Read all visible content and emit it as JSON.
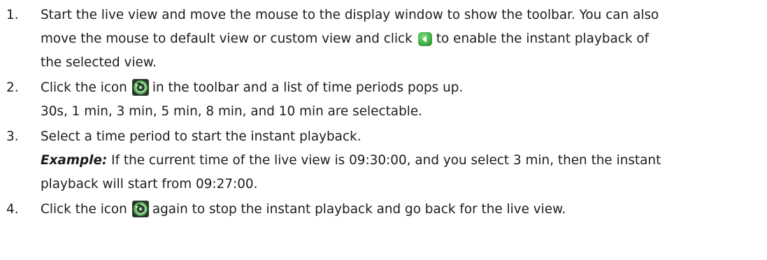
{
  "steps": [
    {
      "number": "1.",
      "line1": "Start the live view and move the mouse to the display window to show the toolbar. You can also",
      "line2_pre": "move the mouse to default view or custom view and click",
      "line2_icon": "green-back-arrow-icon",
      "line2_post": "to enable the instant playback of",
      "line3": "the selected view."
    },
    {
      "number": "2.",
      "line1_pre": "Click the icon",
      "line1_icon": "instant-playback-icon",
      "line1_post": "in the toolbar and a list of time periods pops up.",
      "line2": "30s, 1 min, 3 min, 5 min, 8 min, and 10 min are selectable."
    },
    {
      "number": "3.",
      "line1": "Select a time period to start the instant playback.",
      "example_label": "Example:",
      "line2_post": "If the current time of the live view is 09:30:00, and you select 3 min, then the instant",
      "line3": "playback will start from 09:27:00."
    },
    {
      "number": "4.",
      "line1_pre": "Click the icon",
      "line1_icon": "instant-playback-icon",
      "line1_post": "again to stop the instant playback and go back for the live view."
    }
  ],
  "colors": {
    "text": "#1c1c1c",
    "green_icon": "#3cb043",
    "playback_icon_dark": "#2a3a2a",
    "playback_icon_green": "#5fbf5f"
  }
}
